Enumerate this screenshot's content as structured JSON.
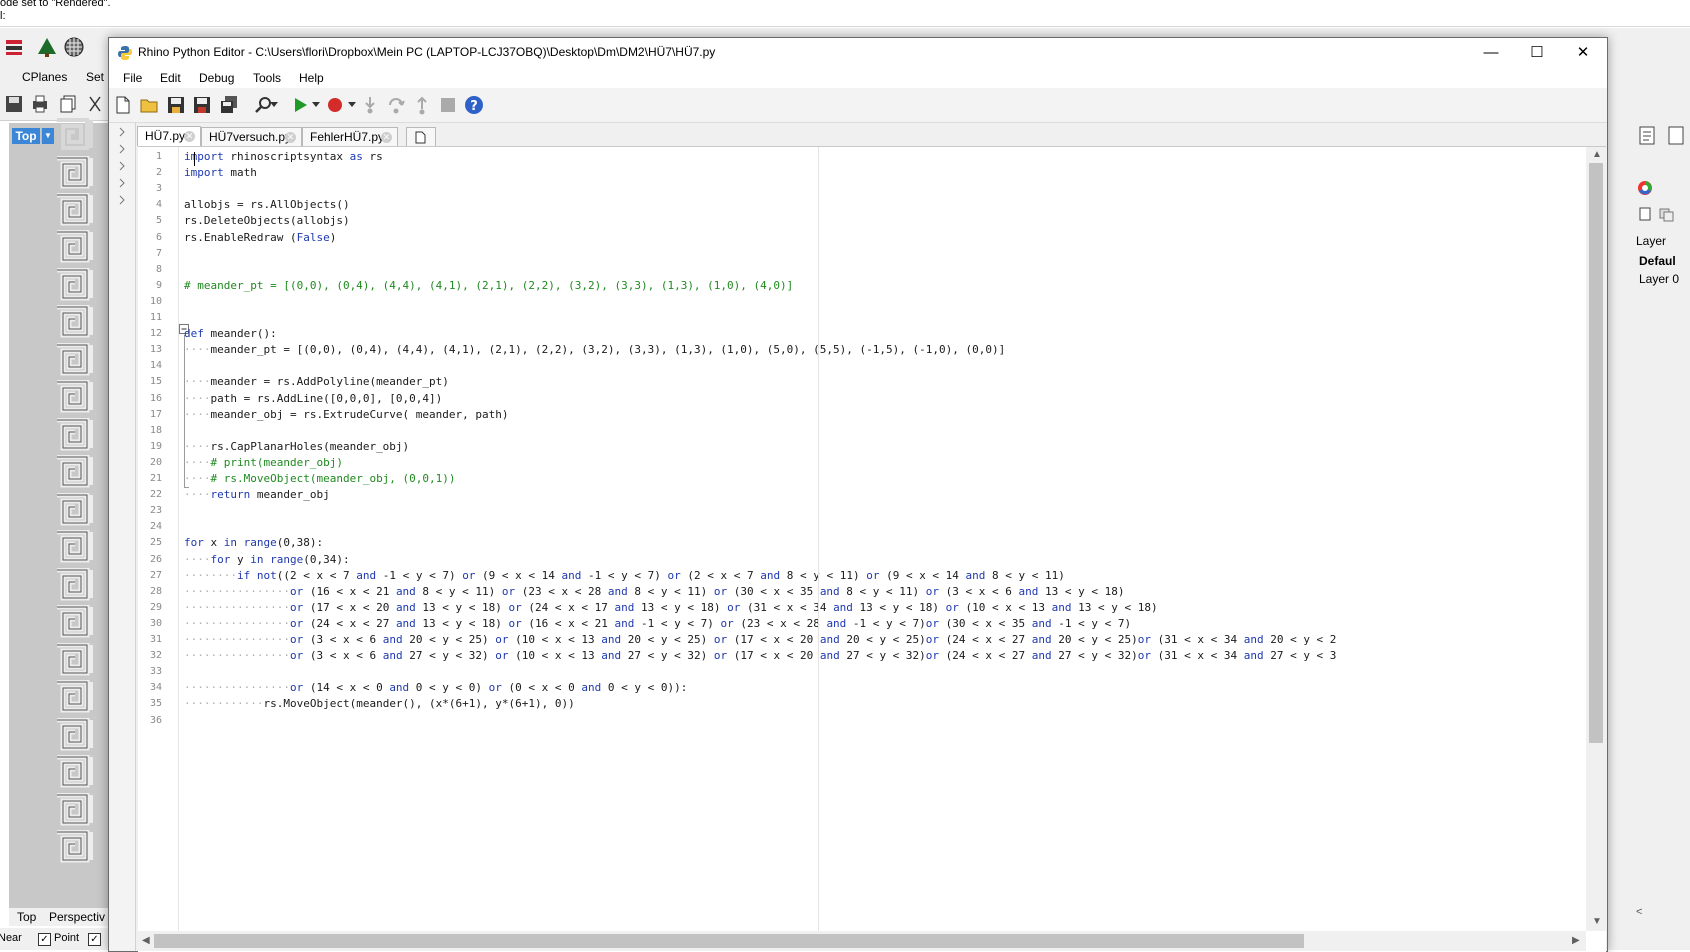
{
  "rhino": {
    "command_history": [
      "ode set to \"Rendered\".",
      "l:"
    ],
    "tabs": [
      "CPlanes",
      "Set"
    ],
    "viewport_label": "Top",
    "viewport_tabs": [
      "Top",
      "Perspectiv"
    ],
    "status": [
      "Near",
      "Point"
    ],
    "right_panel": {
      "layer_header": "Layer",
      "default_layer": "Defaul",
      "layer0": "Layer 0"
    }
  },
  "editor": {
    "title": "Rhino Python Editor - C:\\Users\\flori\\Dropbox\\Mein PC (LAPTOP-LCJ37OBQ)\\Desktop\\Dm\\DM2\\HÜ7\\HÜ7.py",
    "window_controls": {
      "minimize": "—",
      "maximize": "☐",
      "close": "✕"
    },
    "menu": [
      "File",
      "Edit",
      "Debug",
      "Tools",
      "Help"
    ],
    "tabs": [
      {
        "label": "HÜ7.py",
        "active": true
      },
      {
        "label": "HÜ7versuch.py",
        "active": false
      },
      {
        "label": "FehlerHÜ7.py",
        "active": false
      }
    ],
    "line_numbers": [
      "1",
      "2",
      "3",
      "4",
      "5",
      "6",
      "7",
      "8",
      "9",
      "10",
      "11",
      "12",
      "13",
      "14",
      "15",
      "16",
      "17",
      "18",
      "19",
      "20",
      "21",
      "22",
      "23",
      "24",
      "25",
      "26",
      "27",
      "28",
      "29",
      "30",
      "31",
      "32",
      "33",
      "34",
      "35",
      "36"
    ],
    "code_lines": [
      "import rhinoscriptsyntax as rs",
      "import math",
      "",
      "allobjs = rs.AllObjects()",
      "rs.DeleteObjects(allobjs)",
      "rs.EnableRedraw (False)",
      "",
      "",
      "# meander_pt = [(0,0), (0,4), (4,4), (4,1), (2,1), (2,2), (3,2), (3,3), (1,3), (1,0), (4,0)]",
      "",
      "",
      "def meander():",
      "····meander_pt = [(0,0), (0,4), (4,4), (4,1), (2,1), (2,2), (3,2), (3,3), (1,3), (1,0), (5,0), (5,5), (-1,5), (-1,0), (0,0)]",
      "",
      "····meander = rs.AddPolyline(meander_pt)",
      "····path = rs.AddLine([0,0,0], [0,0,4])",
      "····meander_obj = rs.ExtrudeCurve( meander, path)",
      "",
      "····rs.CapPlanarHoles(meander_obj)",
      "····# print(meander_obj)",
      "····# rs.MoveObject(meander_obj, (0,0,1))",
      "····return meander_obj",
      "",
      "",
      "for x in range(0,38):",
      "····for y in range(0,34):",
      "········if not((2 < x < 7 and -1 < y < 7) or (9 < x < 14 and -1 < y < 7) or (2 < x < 7 and 8 < y < 11) or (9 < x < 14 and 8 < y < 11)",
      "················or (16 < x < 21 and 8 < y < 11) or (23 < x < 28 and 8 < y < 11) or (30 < x < 35 and 8 < y < 11) or (3 < x < 6 and 13 < y < 18)",
      "················or (17 < x < 20 and 13 < y < 18) or (24 < x < 17 and 13 < y < 18) or (31 < x < 34 and 13 < y < 18) or (10 < x < 13 and 13 < y < 18)",
      "················or (24 < x < 27 and 13 < y < 18) or (16 < x < 21 and -1 < y < 7) or (23 < x < 28 and -1 < y < 7)or (30 < x < 35 and -1 < y < 7)",
      "················or (3 < x < 6 and 20 < y < 25) or (10 < x < 13 and 20 < y < 25) or (17 < x < 20 and 20 < y < 25)or (24 < x < 27 and 20 < y < 25)or (31 < x < 34 and 20 < y < 2",
      "················or (3 < x < 6 and 27 < y < 32) or (10 < x < 13 and 27 < y < 32) or (17 < x < 20 and 27 < y < 32)or (24 < x < 27 and 27 < y < 32)or (31 < x < 34 and 27 < y < 3",
      "",
      "················or (14 < x < 0 and 0 < y < 0) or (0 < x < 0 and 0 < y < 0)):",
      "············rs.MoveObject(meander(), (x*(6+1), y*(6+1), 0))",
      ""
    ]
  }
}
